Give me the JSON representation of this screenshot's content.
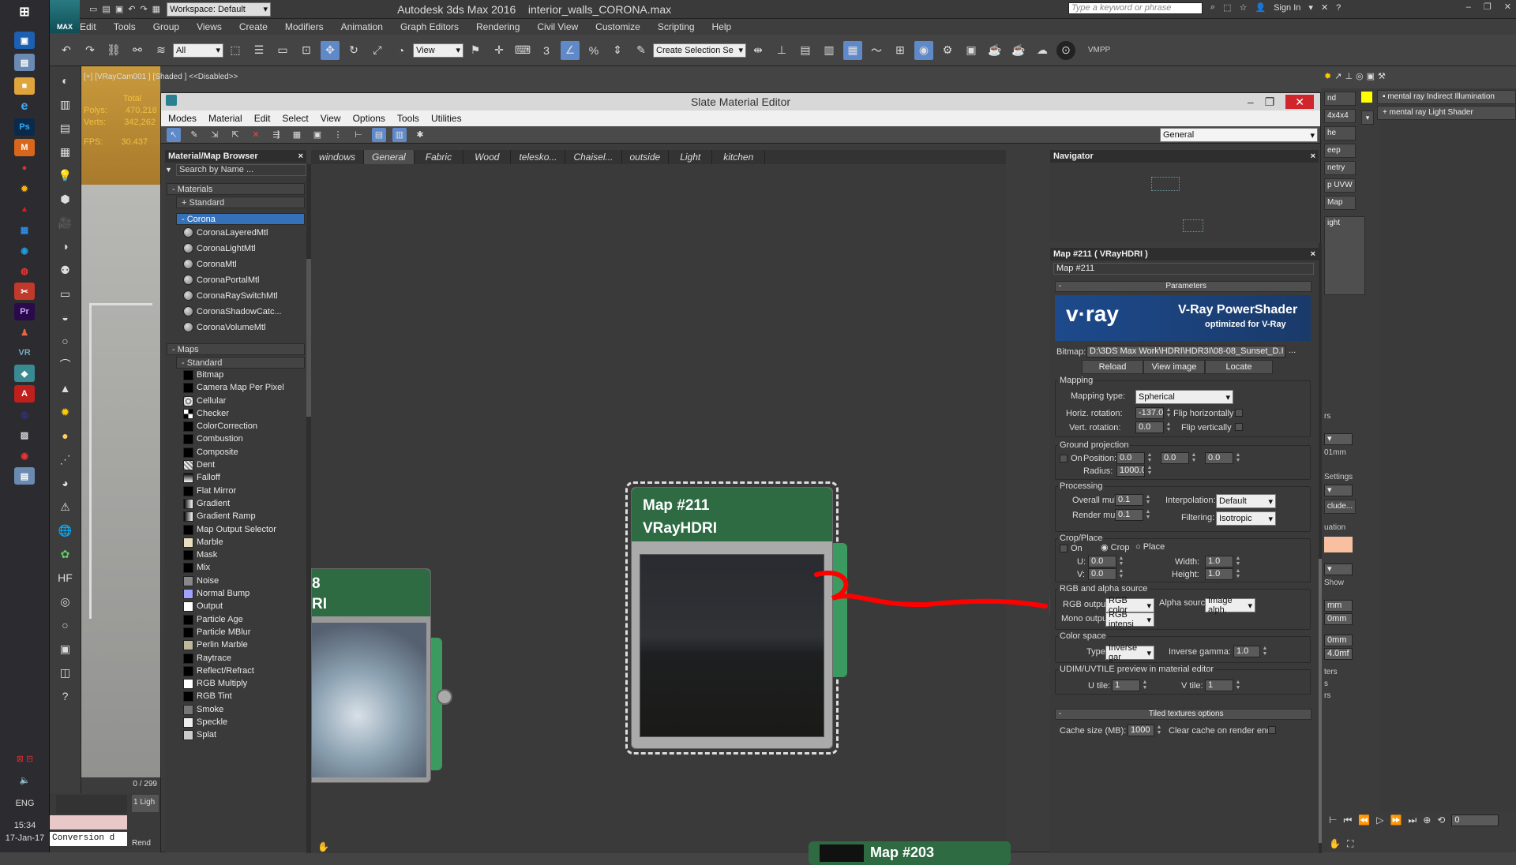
{
  "app": {
    "title": "Autodesk 3ds Max 2016",
    "filename": "interior_walls_CORONA.max",
    "workspace_label": "Workspace: Default",
    "search_placeholder": "Type a keyword or phrase",
    "sign_in": "Sign In",
    "logo_text": "MAX"
  },
  "menubar": [
    "Edit",
    "Tools",
    "Group",
    "Views",
    "Create",
    "Modifiers",
    "Animation",
    "Graph Editors",
    "Rendering",
    "Civil View",
    "Customize",
    "Scripting",
    "Help"
  ],
  "main_toolbar": {
    "selection_filter": "All",
    "ref_coord": "View",
    "named_selection_placeholder": "Create Selection Se",
    "vmpp_label": "VMPP"
  },
  "viewport": {
    "label": "[+] [VRayCam001 ] [Shaded ] <<Disabled>>",
    "stats": [
      {
        "label": "Total",
        "value": ""
      },
      {
        "label": "Polys:",
        "value": "470,218"
      },
      {
        "label": "Verts:",
        "value": "342,262"
      },
      {
        "label": "FPS:",
        "value": "30.437"
      }
    ]
  },
  "slate": {
    "title": "Slate Material Editor",
    "menu": [
      "Modes",
      "Material",
      "Edit",
      "Select",
      "View",
      "Options",
      "Tools",
      "Utilities"
    ],
    "dropdown": "General",
    "view_tabs": [
      "windows",
      "General",
      "Fabric",
      "Wood",
      "telesko...",
      "Chaisel...",
      "outside",
      "Light",
      "kitchen"
    ],
    "active_view_tab": "General"
  },
  "browser": {
    "title": "Material/Map Browser",
    "search_placeholder": "Search by Name ...",
    "materials_group": "Materials",
    "standard_group": "Standard",
    "corona_group": "Corona",
    "corona_items": [
      "CoronaLayeredMtl",
      "CoronaLightMtl",
      "CoronaMtl",
      "CoronaPortalMtl",
      "CoronaRaySwitchMtl",
      "CoronaShadowCatc...",
      "CoronaVolumeMtl"
    ],
    "maps_group": "Maps",
    "maps_standard": "Standard",
    "map_items": [
      "Bitmap",
      "Camera Map Per Pixel",
      "Cellular",
      "Checker",
      "ColorCorrection",
      "Combustion",
      "Composite",
      "Dent",
      "Falloff",
      "Flat Mirror",
      "Gradient",
      "Gradient Ramp",
      "Map Output Selector",
      "Marble",
      "Mask",
      "Mix",
      "Noise",
      "Normal Bump",
      "Output",
      "Particle Age",
      "Particle MBlur",
      "Perlin Marble",
      "Raytrace",
      "Reflect/Refract",
      "RGB Multiply",
      "RGB Tint",
      "Smoke",
      "Speckle",
      "Splat"
    ]
  },
  "nodes": {
    "main": {
      "line1": "Map #211",
      "line2": "VRayHDRI"
    },
    "side": {
      "line1": "8",
      "line2": "RI"
    },
    "bottom": {
      "line1": "Map #203"
    }
  },
  "navigator": {
    "title": "Navigator"
  },
  "parameters": {
    "panel_title": "Map #211  ( VRayHDRI )",
    "name_field": "Map #211",
    "rollout": "Parameters",
    "vray_brand": "v·ray",
    "vray_title": "V-Ray PowerShader",
    "vray_sub": "optimized for V-Ray",
    "bitmap_label": "Bitmap:",
    "bitmap_path": "D:\\3DS Max Work\\HDRI\\HDR3I\\08-08_Sunset_D.I",
    "bitmap_browse": "...",
    "reload": "Reload",
    "view_image": "View image",
    "locate": "Locate",
    "mapping": {
      "section": "Mapping",
      "type_label": "Mapping type:",
      "type_value": "Spherical",
      "horiz_label": "Horiz. rotation:",
      "horiz_value": "-137.0",
      "vert_label": "Vert. rotation:",
      "vert_value": "0.0",
      "flip_h": "Flip horizontally",
      "flip_v": "Flip vertically"
    },
    "ground": {
      "section": "Ground projection",
      "on": "On",
      "position_label": "Position:",
      "pos": [
        "0.0",
        "0.0",
        "0.0"
      ],
      "radius_label": "Radius:",
      "radius_value": "1000.0"
    },
    "processing": {
      "section": "Processing",
      "overall_label": "Overall mult:",
      "overall_value": "0.1",
      "render_label": "Render mult:",
      "render_value": "0.1",
      "interp_label": "Interpolation:",
      "interp_value": "Default",
      "filter_label": "Filtering:",
      "filter_value": "Isotropic"
    },
    "crop": {
      "section": "Crop/Place",
      "on": "On",
      "crop": "Crop",
      "place": "Place",
      "u_label": "U:",
      "u_value": "0.0",
      "v_label": "V:",
      "v_value": "0.0",
      "w_label": "Width:",
      "w_value": "1.0",
      "h_label": "Height:",
      "h_value": "1.0"
    },
    "rgb": {
      "section": "RGB and alpha source",
      "rgb_label": "RGB output:",
      "rgb_value": "RGB color",
      "alpha_label": "Alpha source:",
      "alpha_value": "Image alph.",
      "mono_label": "Mono output:",
      "mono_value": "RGB intensi"
    },
    "colorspace": {
      "section": "Color space",
      "type_label": "Type:",
      "type_value": "Inverse gar",
      "gamma_label": "Inverse gamma:",
      "gamma_value": "1.0"
    },
    "udim": {
      "section": "UDIM/UVTILE preview in material editor",
      "u_label": "U tile:",
      "u_value": "1",
      "v_label": "V tile:",
      "v_value": "1"
    },
    "tiled": {
      "rollout": "Tiled textures options",
      "cache_label": "Cache size (MB):",
      "cache_value": "1000",
      "clear_label": "Clear cache on render end"
    }
  },
  "command_panel": {
    "list": [
      "mental ray Indirect Illumination",
      "mental ray Light Shader"
    ],
    "stub_labels": [
      "nd",
      "4x4x4",
      "he",
      "eep",
      "netry",
      "p UVW",
      "Map",
      "ight"
    ],
    "lower_labels": [
      "rs",
      "01mm",
      "Settings",
      "clude...",
      "uation",
      "Show",
      "mm",
      "0mm",
      "0mm",
      "4.0mf",
      "ters",
      "s",
      "rs"
    ]
  },
  "status": {
    "frame": "0 / 299",
    "lights_count": "1 Ligh",
    "render_label": "Rend",
    "conversion": "Conversion d",
    "lang": "ENG",
    "time": "15:34",
    "date": "17-Jan-17",
    "frame_field": "0"
  },
  "colors": {
    "node_green": "#2e6b43",
    "accent_blue": "#5f89c8",
    "annotation_red": "#ff0000"
  }
}
